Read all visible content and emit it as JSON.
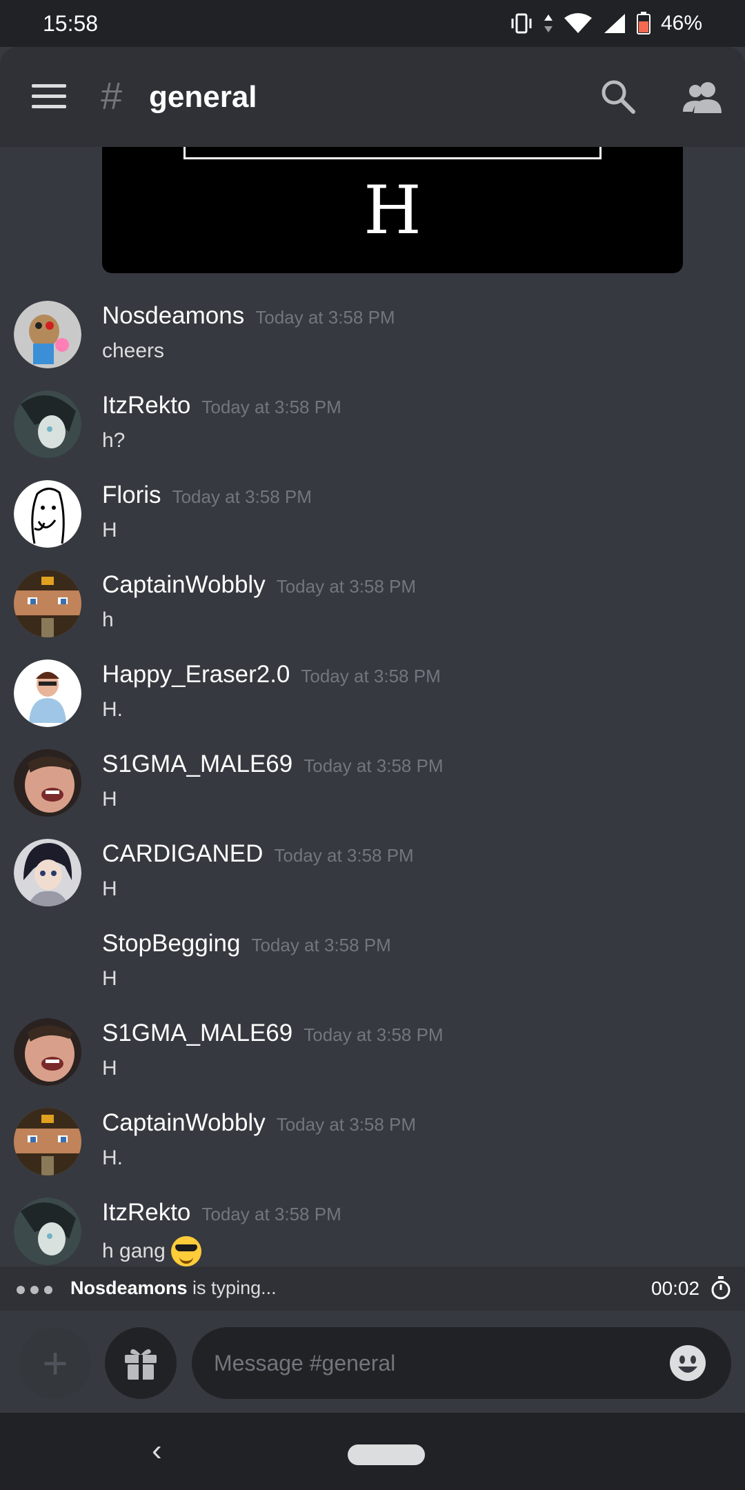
{
  "status_bar": {
    "time": "15:58",
    "battery": "46%"
  },
  "header": {
    "channel": "general",
    "hash_symbol": "#"
  },
  "embed": {
    "letter": "H"
  },
  "messages": [
    {
      "username": "Nosdeamons",
      "timestamp": "Today at 3:58 PM",
      "text": "cheers"
    },
    {
      "username": "ItzRekto",
      "timestamp": "Today at 3:58 PM",
      "text": "h?"
    },
    {
      "username": "Floris",
      "timestamp": "Today at 3:58 PM",
      "text": "H"
    },
    {
      "username": "CaptainWobbly",
      "timestamp": "Today at 3:58 PM",
      "text": "h"
    },
    {
      "username": "Happy_Eraser2.0",
      "timestamp": "Today at 3:58 PM",
      "text": "H."
    },
    {
      "username": "S1GMA_MALE69",
      "timestamp": "Today at 3:58 PM",
      "text": "H"
    },
    {
      "username": "CARDIGANED",
      "timestamp": "Today at 3:58 PM",
      "text": "H"
    },
    {
      "username": "StopBegging",
      "timestamp": "Today at 3:58 PM",
      "text": "H"
    },
    {
      "username": "S1GMA_MALE69",
      "timestamp": "Today at 3:58 PM",
      "text": "H"
    },
    {
      "username": "CaptainWobbly",
      "timestamp": "Today at 3:58 PM",
      "text": "H."
    },
    {
      "username": "ItzRekto",
      "timestamp": "Today at 3:58 PM",
      "text": "h gang",
      "emoji": "sunglasses-emoji"
    }
  ],
  "typing": {
    "user": "Nosdeamons",
    "suffix": " is typing...",
    "timer": "00:02"
  },
  "composer": {
    "placeholder": "Message #general"
  },
  "colors": {
    "background": "#36393f",
    "header": "#2f3136",
    "system_bar": "#202225",
    "timestamp": "#72767d"
  }
}
